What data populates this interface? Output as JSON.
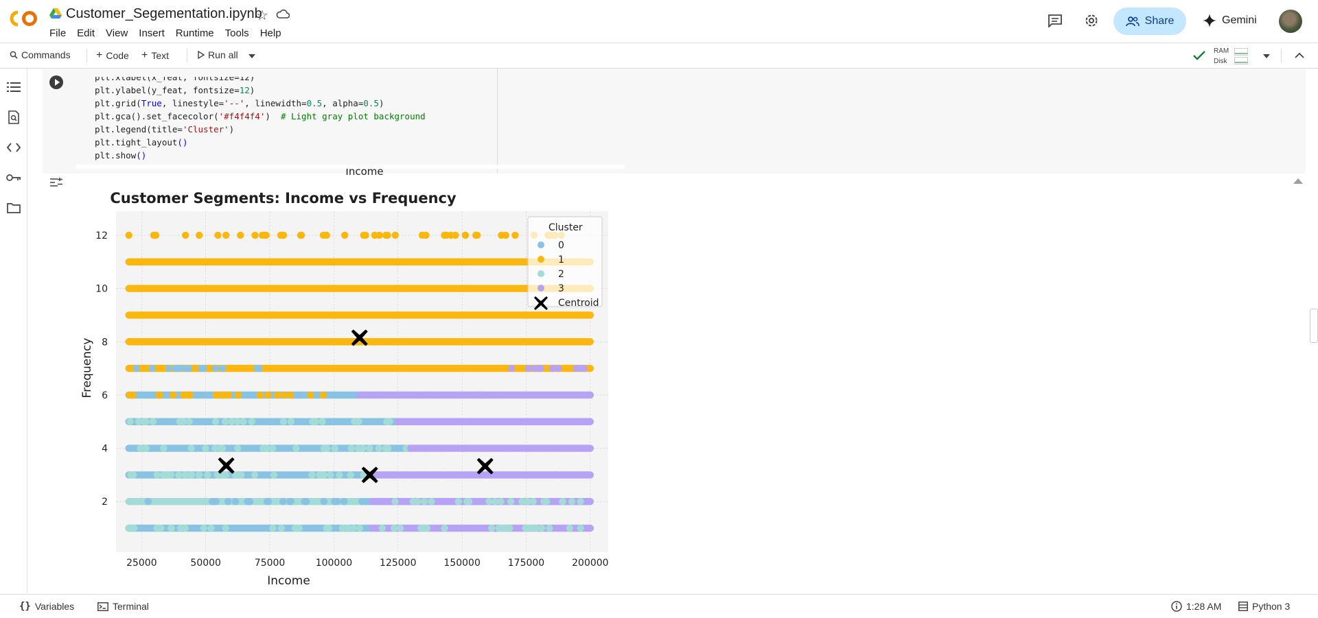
{
  "notebook": {
    "title": "Customer_Segementation.ipynb"
  },
  "menu": [
    "File",
    "Edit",
    "View",
    "Insert",
    "Runtime",
    "Tools",
    "Help"
  ],
  "header": {
    "share_label": "Share",
    "gemini_label": "Gemini"
  },
  "toolbar": {
    "commands": "Commands",
    "code": "Code",
    "text": "Text",
    "run_all": "Run all",
    "ram": "RAM",
    "disk": "Disk"
  },
  "code_lines": [
    "plt.xlabel(x_feat, fontsize=12)",
    "plt.ylabel(y_feat, fontsize=12)",
    "plt.grid(True, linestyle='--', linewidth=0.5, alpha=0.5)",
    "plt.gca().set_facecolor('#f4f4f4')  # Light gray plot background",
    "plt.legend(title='Cluster')",
    "plt.tight_layout()",
    "plt.show()"
  ],
  "clipped_label": "Income",
  "statusbar": {
    "variables": "Variables",
    "terminal": "Terminal",
    "time": "1:28 AM",
    "kernel": "Python 3"
  },
  "colors": {
    "cluster0": "#89c3e3",
    "cluster1": "#fbb70e",
    "cluster2": "#a3dbd6",
    "cluster3": "#b6a3f5",
    "centroid": "#000000",
    "plot_bg": "#f4f4f4"
  },
  "chart_data": {
    "type": "scatter",
    "title": "Customer Segments: Income vs Frequency",
    "xlabel": "Income",
    "ylabel": "Frequency",
    "xlim": [
      15000,
      207000
    ],
    "ylim": [
      0.1,
      12.9
    ],
    "xticks": [
      25000,
      50000,
      75000,
      100000,
      125000,
      150000,
      175000,
      200000
    ],
    "yticks": [
      2,
      4,
      6,
      8,
      10,
      12
    ],
    "grid": true,
    "legend": {
      "title": "Cluster",
      "placement": "top-right",
      "entries": [
        "0",
        "1",
        "2",
        "3",
        "Centroid"
      ]
    },
    "x_min": 20000,
    "x_max": 200000,
    "bands": [
      {
        "y": 12,
        "segments": [
          {
            "cluster": "1",
            "from": 20000,
            "to": 200000,
            "sparse": true
          }
        ]
      },
      {
        "y": 11,
        "segments": [
          {
            "cluster": "1",
            "from": 20000,
            "to": 200000
          }
        ]
      },
      {
        "y": 10,
        "segments": [
          {
            "cluster": "1",
            "from": 20000,
            "to": 200000
          }
        ]
      },
      {
        "y": 9,
        "segments": [
          {
            "cluster": "1",
            "from": 20000,
            "to": 200000
          }
        ]
      },
      {
        "y": 8,
        "segments": [
          {
            "cluster": "1",
            "from": 20000,
            "to": 200000
          }
        ]
      },
      {
        "y": 7,
        "segments": [
          {
            "cluster": "1",
            "from": 20000,
            "to": 200000
          },
          {
            "cluster": "0",
            "from": 20000,
            "to": 75000,
            "sparse": true
          },
          {
            "cluster": "3",
            "from": 160000,
            "to": 200000,
            "sparse": true
          }
        ]
      },
      {
        "y": 6,
        "segments": [
          {
            "cluster": "0",
            "from": 20000,
            "to": 110000
          },
          {
            "cluster": "1",
            "from": 20000,
            "to": 175000,
            "sparse": true
          },
          {
            "cluster": "3",
            "from": 110000,
            "to": 200000
          }
        ]
      },
      {
        "y": 5,
        "segments": [
          {
            "cluster": "0",
            "from": 20000,
            "to": 125000
          },
          {
            "cluster": "2",
            "from": 20000,
            "to": 200000,
            "sparse": true
          },
          {
            "cluster": "3",
            "from": 125000,
            "to": 200000
          }
        ]
      },
      {
        "y": 4,
        "segments": [
          {
            "cluster": "0",
            "from": 20000,
            "to": 130000
          },
          {
            "cluster": "2",
            "from": 20000,
            "to": 200000,
            "sparse": true
          },
          {
            "cluster": "3",
            "from": 130000,
            "to": 200000
          }
        ]
      },
      {
        "y": 3,
        "segments": [
          {
            "cluster": "0",
            "from": 20000,
            "to": 115000
          },
          {
            "cluster": "2",
            "from": 20000,
            "to": 200000,
            "sparse": true
          },
          {
            "cluster": "3",
            "from": 115000,
            "to": 200000
          }
        ]
      },
      {
        "y": 2,
        "segments": [
          {
            "cluster": "2",
            "from": 20000,
            "to": 115000
          },
          {
            "cluster": "0",
            "from": 20000,
            "to": 115000,
            "sparse": true
          },
          {
            "cluster": "3",
            "from": 115000,
            "to": 200000
          },
          {
            "cluster": "2",
            "from": 115000,
            "to": 200000,
            "sparse": true
          }
        ]
      },
      {
        "y": 1,
        "segments": [
          {
            "cluster": "0",
            "from": 20000,
            "to": 115000
          },
          {
            "cluster": "2",
            "from": 20000,
            "to": 115000,
            "sparse": true
          },
          {
            "cluster": "3",
            "from": 115000,
            "to": 200000
          },
          {
            "cluster": "2",
            "from": 115000,
            "to": 200000,
            "sparse": true
          }
        ]
      }
    ],
    "centroids": [
      {
        "x": 110000,
        "y": 8.15
      },
      {
        "x": 58000,
        "y": 3.35
      },
      {
        "x": 114000,
        "y": 3.0
      },
      {
        "x": 159000,
        "y": 3.33
      }
    ]
  }
}
